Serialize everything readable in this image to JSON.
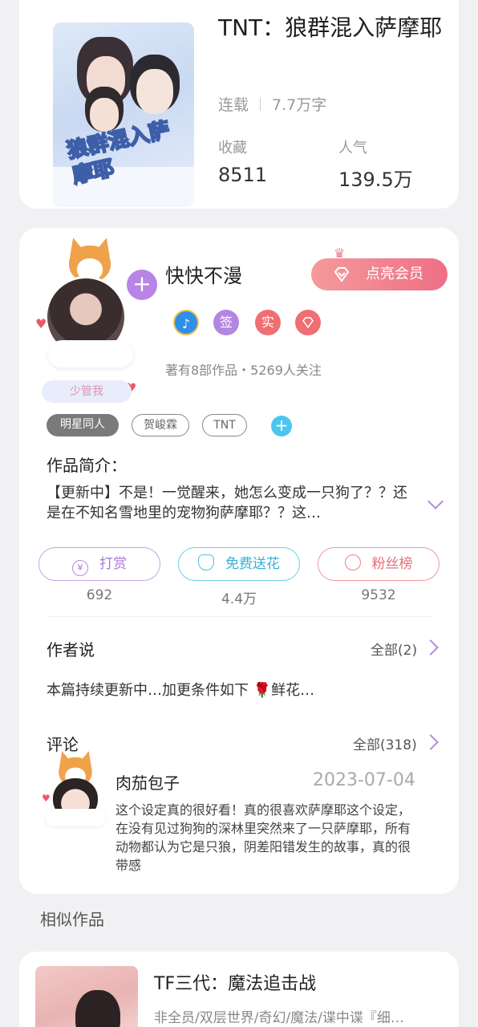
{
  "book": {
    "title": "TNT：狼群混入萨摩耶",
    "status": "连载",
    "word_count": "7.7万字",
    "favorites_label": "收藏",
    "favorites_value": "8511",
    "popularity_label": "人气",
    "popularity_value": "139.5万",
    "cover_title": "狼群混入萨摩耶"
  },
  "author": {
    "name": "快快不漫",
    "vip_button": "点亮会员",
    "avatar_tag": "少管我",
    "badges": [
      "签",
      "实"
    ],
    "stats": "著有8部作品・5269人关注"
  },
  "tags": [
    "明星同人",
    "贺峻霖",
    "TNT"
  ],
  "intro": {
    "label": "作品简介：",
    "text": "【更新中】不是！一觉醒来，她怎么变成一只狗了？？还是在不知名雪地里的宠物狗萨摩耶？？这…"
  },
  "actions": [
    {
      "label": "打赏",
      "count": "692",
      "color": "#b78ae0",
      "icon": "yen-icon"
    },
    {
      "label": "免费送花",
      "count": "4.4万",
      "color": "#4fc4e6",
      "icon": "flower-icon"
    },
    {
      "label": "粉丝榜",
      "count": "9532",
      "color": "#ee7f86",
      "icon": "fans-icon"
    }
  ],
  "author_says": {
    "label": "作者说",
    "more": "全部(2)",
    "text": "本篇持续更新中…加更条件如下 🌹鲜花…"
  },
  "comments": {
    "label": "评论",
    "more": "全部(318)",
    "items": [
      {
        "user": "肉茄包子",
        "date": "2023-07-04",
        "text": "这个设定真的很好看！真的很喜欢萨摩耶这个设定，在没有见过狗狗的深林里突然来了一只萨摩耶，所有动物都认为它是只狼，阴差阳错发生的故事，真的很带感"
      }
    ]
  },
  "similar": {
    "label": "相似作品",
    "items": [
      {
        "title": "TF三代：魔法追击战",
        "desc": "非全员/双层世界/奇幻/魔法/谍中谍『细…"
      }
    ]
  }
}
